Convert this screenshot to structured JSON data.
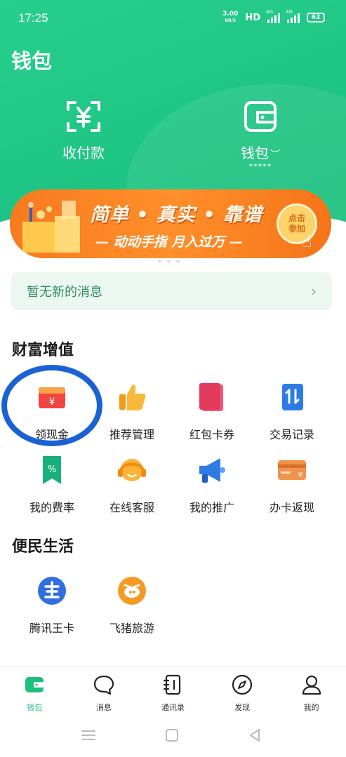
{
  "status_bar": {
    "time": "17:25",
    "net_speed_value": "3.00",
    "net_speed_unit": "KB/S",
    "hd": "HD",
    "signal_1": "4G",
    "signal_2": "4G",
    "battery": "62"
  },
  "header": {
    "title": "钱包",
    "pay_label": "收付款",
    "wallet_label": "钱包",
    "wallet_balance_masked": "*****"
  },
  "banner": {
    "title": "简单 • 真实 • 靠谱",
    "subtitle": "— 动动手指  月入过万 —",
    "button_line1": "点击",
    "button_line2": "参加"
  },
  "notice": {
    "text": "暂无新的消息",
    "arrow": "›"
  },
  "wealth": {
    "title": "财富增值",
    "items": [
      {
        "label": "领现金",
        "icon": "cash-envelope-icon"
      },
      {
        "label": "推荐管理",
        "icon": "thumbs-up-icon"
      },
      {
        "label": "红包卡券",
        "icon": "red-packet-icon"
      },
      {
        "label": "交易记录",
        "icon": "transaction-record-icon"
      },
      {
        "label": "我的费率",
        "icon": "rate-bookmark-icon"
      },
      {
        "label": "在线客服",
        "icon": "headset-icon"
      },
      {
        "label": "我的推广",
        "icon": "megaphone-icon"
      },
      {
        "label": "办卡返现",
        "icon": "card-cashback-icon"
      }
    ]
  },
  "life": {
    "title": "便民生活",
    "items": [
      {
        "label": "腾讯王卡",
        "icon": "tencent-king-card-icon"
      },
      {
        "label": "飞猪旅游",
        "icon": "fliggy-travel-icon"
      }
    ]
  },
  "tabbar": {
    "items": [
      {
        "label": "钱包",
        "icon": "wallet-icon",
        "active": true
      },
      {
        "label": "消息",
        "icon": "message-icon",
        "active": false
      },
      {
        "label": "通讯录",
        "icon": "contacts-icon",
        "active": false
      },
      {
        "label": "发现",
        "icon": "compass-icon",
        "active": false
      },
      {
        "label": "我的",
        "icon": "profile-icon",
        "active": false
      }
    ]
  },
  "colors": {
    "brand_green": "#1fc584",
    "banner_orange": "#f77a1f",
    "annotation_blue": "#1a62d4"
  }
}
